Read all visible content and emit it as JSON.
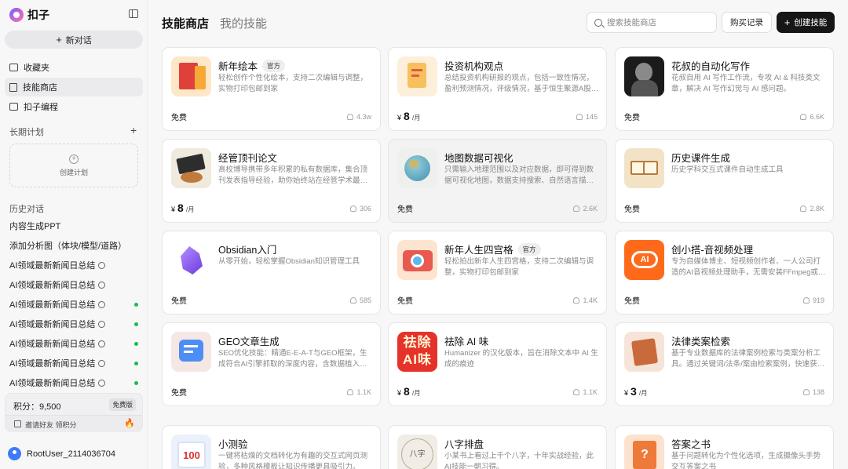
{
  "brand": {
    "name": "扣子"
  },
  "sidebar": {
    "new_chat": "新对话",
    "nav": [
      {
        "label": "收藏夹",
        "icon": "folder-icon"
      },
      {
        "label": "技能商店",
        "icon": "book-icon"
      },
      {
        "label": "扣子编程",
        "icon": "code-icon"
      }
    ],
    "long_term_plan": "长期计划",
    "create_plan": "创建计划",
    "history_title": "历史对话",
    "history": [
      "内容生成PPT",
      "添加分析图（体块/模型/道路）",
      "AI领域最新新闻日总结",
      "AI领域最新新闻日总结",
      "AI领域最新新闻日总结",
      "AI领域最新新闻日总结",
      "AI领域最新新闻日总结",
      "AI领域最新新闻日总结",
      "AI领域最新新闻日总结"
    ],
    "points_label": "积分：",
    "points_value": "9,500",
    "plan_badge": "免费版",
    "invite": "邀请好友 领积分",
    "user": "RootUser_2114036704"
  },
  "header": {
    "tab_store": "技能商店",
    "tab_mine": "我的技能",
    "search_placeholder": "搜索技能商店",
    "records": "购买记录",
    "create": "创建技能"
  },
  "cards": [
    {
      "title": "新年绘本",
      "badge": "官方",
      "desc": "轻松创作个性化绘本，支持二次编辑与调整，实物打印包邮到家",
      "price_text": "免费",
      "users": "4.3w"
    },
    {
      "title": "投资机构观点",
      "badge": "",
      "desc": "总结投资机构研报的观点，包括一致性情况，盈利预测情况，评级情况，基于恒生聚源A股数据",
      "price_currency": "¥",
      "price_amount": "8",
      "price_unit": "/月",
      "users": "145"
    },
    {
      "title": "花叔的自动化写作",
      "badge": "",
      "desc": "花叔自用 AI 写作工作流，专攻 AI & 科技类文章，解决 AI 写作幻觉与 AI 感问题。",
      "price_text": "免费",
      "users": "6.6K"
    },
    {
      "title": "经管顶刊论文",
      "badge": "",
      "desc": "高校博导携带多年积累的私有数据库，集合顶刊发表指导经验，助你始终站在经管学术最前沿。",
      "price_currency": "¥",
      "price_amount": "8",
      "price_unit": "/月",
      "users": "306"
    },
    {
      "title": "地图数据可视化",
      "badge": "",
      "desc": "只需输入地理范围以及对应数据，即可得到数据可视化地图，数据支持搜索、自然语言描述、表格上传",
      "price_text": "免费",
      "users": "2.6K"
    },
    {
      "title": "历史课件生成",
      "badge": "",
      "desc": "历史学科交互式课件自动生成工具",
      "price_text": "免费",
      "users": "2.8K"
    },
    {
      "title": "Obsidian入门",
      "badge": "",
      "desc": "从零开始，轻松掌握Obsidian知识管理工具",
      "price_text": "免费",
      "users": "585"
    },
    {
      "title": "新年人生四宫格",
      "badge": "官方",
      "desc": "轻松拍出新年人生四宫格，支持二次编辑与调整，实物打印包邮到家",
      "price_text": "免费",
      "users": "1.4K"
    },
    {
      "title": "创小搭-音视频处理",
      "badge": "",
      "desc": "专为自媒体博主、短视频创作者、一人公司打造的AI音视频处理助手，无需安装FFmpeg或专业软件",
      "price_text": "免费",
      "users": "919"
    },
    {
      "title": "GEO文章生成",
      "badge": "",
      "desc": "SEO优化技能：精通E-E-A-T与GEO框架，生成符合AI引擎抓取的深度内容，含数据植入与结构化",
      "price_text": "免费",
      "users": "1.1K"
    },
    {
      "title": "祛除 AI 味",
      "badge": "",
      "desc": "Humanizer 的汉化版本，旨在消除文本中 AI 生成的痕迹",
      "price_currency": "¥",
      "price_amount": "8",
      "price_unit": "/月",
      "users": "1.1K"
    },
    {
      "title": "法律类案检索",
      "badge": "",
      "desc": "基于专业数据库的法律案例检索与类案分析工具。通过关键词/法条/案由检索案例，快速获取裁判要旨",
      "price_currency": "¥",
      "price_amount": "3",
      "price_unit": "/月",
      "users": "138"
    },
    {
      "title": "小测验",
      "badge": "",
      "desc": "一键将枯燥的文档转化为有趣的交互式网页测验，多种风格模板让知识传播更具吸引力。",
      "price_text": "",
      "users": ""
    },
    {
      "title": "八字排盘",
      "badge": "",
      "desc": "小某书上看过上千个八字，十年实战经验，此AI技能一朝习得。",
      "price_text": "",
      "users": ""
    },
    {
      "title": "答案之书",
      "badge": "",
      "desc": "基于问题转化为个性化选项，生成摄像头手势交互答案之书",
      "price_text": "",
      "users": ""
    }
  ],
  "thumb_text": {
    "ai_logo": "AI",
    "quchu": "祛除AI味",
    "quiz": "100",
    "bazi": "八字",
    "answer": "?"
  }
}
